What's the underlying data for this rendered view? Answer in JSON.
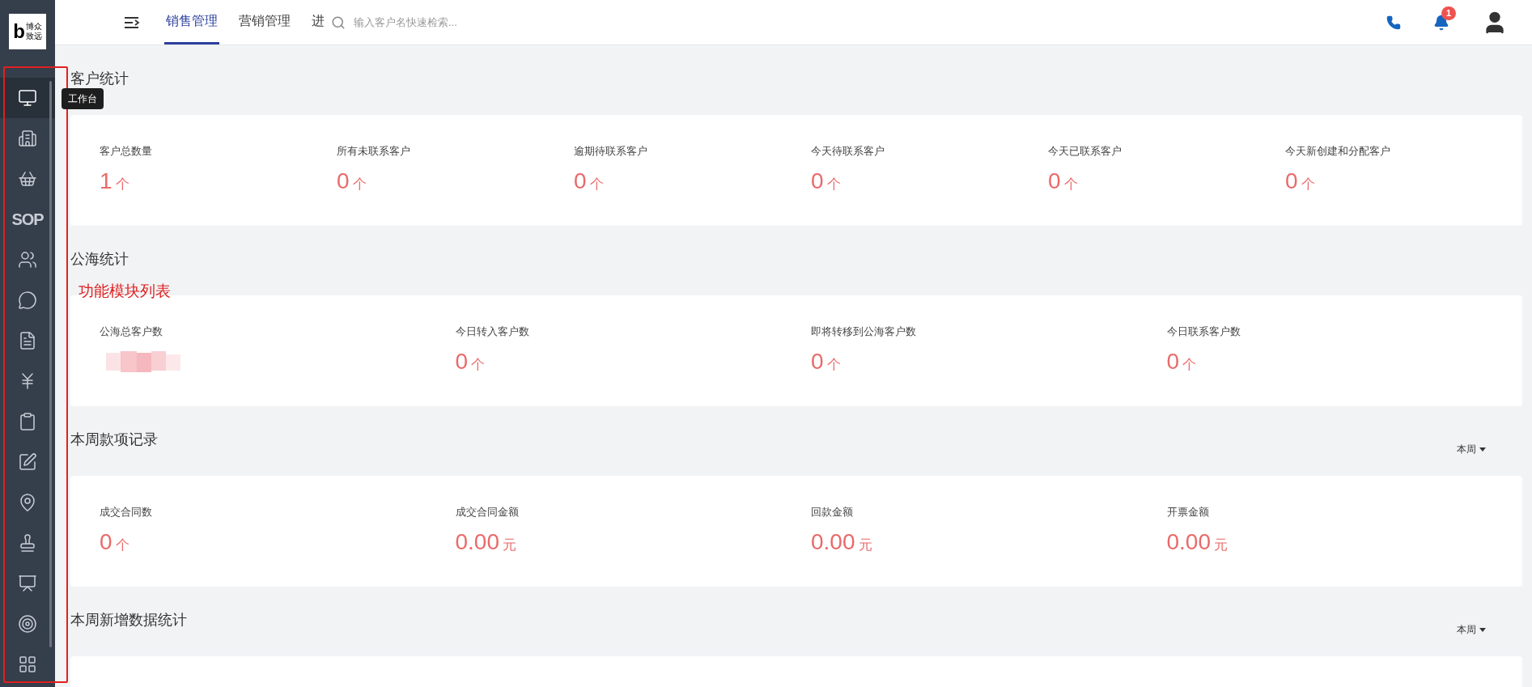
{
  "logo": {
    "mark": "b",
    "line_1": "博众",
    "line_2": "致远"
  },
  "sidebar": {
    "items": [
      {
        "selected": true,
        "tooltip": "工作台"
      },
      {
        "selected": false
      },
      {
        "selected": false
      },
      {
        "selected": false,
        "label": "SOP"
      },
      {
        "selected": false
      },
      {
        "selected": false
      },
      {
        "selected": false
      },
      {
        "selected": false
      },
      {
        "selected": false
      },
      {
        "selected": false
      },
      {
        "selected": false
      },
      {
        "selected": false
      },
      {
        "selected": false
      },
      {
        "selected": false
      },
      {
        "selected": false
      }
    ]
  },
  "header": {
    "tabs": [
      {
        "label": "销售管理",
        "selected": true
      },
      {
        "label": "营销管理",
        "selected": false
      },
      {
        "label": "进",
        "selected": false
      }
    ],
    "search": {
      "placeholder": "输入客户名快速检索..."
    },
    "notifications": {
      "badge": "1"
    }
  },
  "annotation": {
    "label": "功能模块列表"
  },
  "sections": [
    {
      "title": "客户统计",
      "items": [
        {
          "kind": "stat",
          "label": "客户总数量",
          "value": "1",
          "unit": "个"
        },
        {
          "kind": "stat",
          "label": "所有未联系客户",
          "value": "0",
          "unit": "个"
        },
        {
          "kind": "stat",
          "label": "逾期待联系客户",
          "value": "0",
          "unit": "个"
        },
        {
          "kind": "stat",
          "label": "今天待联系客户",
          "value": "0",
          "unit": "个"
        },
        {
          "kind": "stat",
          "label": "今天已联系客户",
          "value": "0",
          "unit": "个"
        },
        {
          "kind": "stat",
          "label": "今天新创建和分配客户",
          "value": "0",
          "unit": "个"
        }
      ]
    },
    {
      "title": "公海统计",
      "items": [
        {
          "kind": "redacted",
          "label": "公海总客户数"
        },
        {
          "kind": "stat",
          "label": "今日转入客户数",
          "value": "0",
          "unit": "个"
        },
        {
          "kind": "stat",
          "label": "即将转移到公海客户数",
          "value": "0",
          "unit": "个"
        },
        {
          "kind": "stat",
          "label": "今日联系客户数",
          "value": "0",
          "unit": "个"
        }
      ]
    },
    {
      "title": "本周款项记录",
      "period": "本周",
      "items": [
        {
          "kind": "stat",
          "label": "成交合同数",
          "value": "0",
          "unit": "个"
        },
        {
          "kind": "stat",
          "label": "成交合同金额",
          "value": "0.00",
          "unit": "元"
        },
        {
          "kind": "stat",
          "label": "回款金额",
          "value": "0.00",
          "unit": "元"
        },
        {
          "kind": "stat",
          "label": "开票金额",
          "value": "0.00",
          "unit": "元"
        }
      ]
    },
    {
      "title": "本周新增数据统计",
      "period": "本周"
    }
  ]
}
